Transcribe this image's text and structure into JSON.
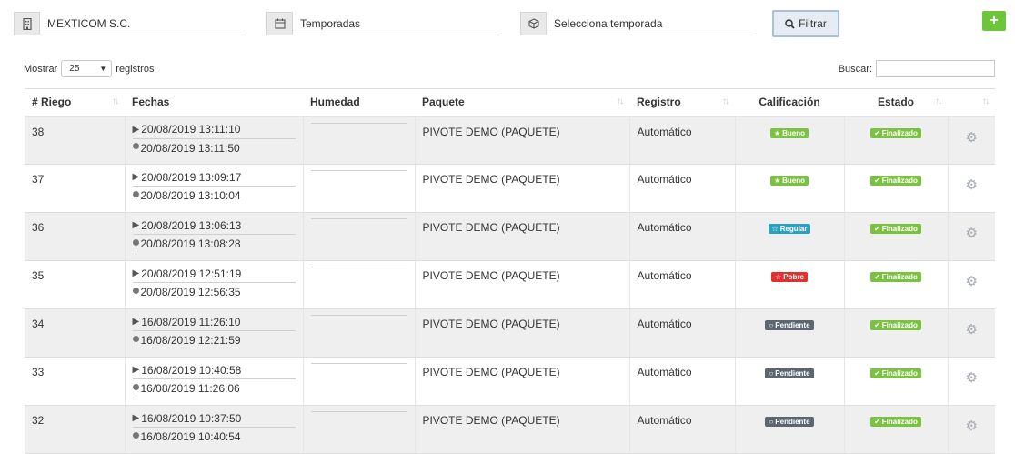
{
  "filters": {
    "client": "MEXTICOM S.C.",
    "season_label": "Temporadas",
    "season_select": "Selecciona temporada",
    "filter_button": "Filtrar",
    "add_button": "+"
  },
  "length": {
    "prefix": "Mostrar",
    "value": "25",
    "suffix": "registros"
  },
  "search": {
    "label": "Buscar:",
    "value": ""
  },
  "table": {
    "headers": {
      "riego": "# Riego",
      "fechas": "Fechas",
      "humedad": "Humedad",
      "paquete": "Paquete",
      "registro": "Registro",
      "calificacion": "Calificación",
      "estado": "Estado"
    },
    "rows": [
      {
        "id": "38",
        "start": "20/08/2019 13:11:10",
        "end": "20/08/2019 13:11:50",
        "paquete": "PIVOTE DEMO (PAQUETE)",
        "registro": "Automático",
        "calificacion": "Bueno",
        "estado": "Finalizado"
      },
      {
        "id": "37",
        "start": "20/08/2019 13:09:17",
        "end": "20/08/2019 13:10:04",
        "paquete": "PIVOTE DEMO (PAQUETE)",
        "registro": "Automático",
        "calificacion": "Bueno",
        "estado": "Finalizado"
      },
      {
        "id": "36",
        "start": "20/08/2019 13:06:13",
        "end": "20/08/2019 13:08:28",
        "paquete": "PIVOTE DEMO (PAQUETE)",
        "registro": "Automático",
        "calificacion": "Regular",
        "estado": "Finalizado"
      },
      {
        "id": "35",
        "start": "20/08/2019 12:51:19",
        "end": "20/08/2019 12:56:35",
        "paquete": "PIVOTE DEMO (PAQUETE)",
        "registro": "Automático",
        "calificacion": "Pobre",
        "estado": "Finalizado"
      },
      {
        "id": "34",
        "start": "16/08/2019 11:26:10",
        "end": "16/08/2019 12:21:59",
        "paquete": "PIVOTE DEMO (PAQUETE)",
        "registro": "Automático",
        "calificacion": "Pendiente",
        "estado": "Finalizado"
      },
      {
        "id": "33",
        "start": "16/08/2019 10:40:58",
        "end": "16/08/2019 11:26:06",
        "paquete": "PIVOTE DEMO (PAQUETE)",
        "registro": "Automático",
        "calificacion": "Pendiente",
        "estado": "Finalizado"
      },
      {
        "id": "32",
        "start": "16/08/2019 10:37:50",
        "end": "16/08/2019 10:40:54",
        "paquete": "PIVOTE DEMO (PAQUETE)",
        "registro": "Automático",
        "calificacion": "Pendiente",
        "estado": "Finalizado"
      }
    ]
  },
  "colors": {
    "accent_green": "#7cc242",
    "regular_blue": "#2f9fc0",
    "pobre_red": "#e3302f",
    "pendiente_gray": "#5b6670"
  }
}
